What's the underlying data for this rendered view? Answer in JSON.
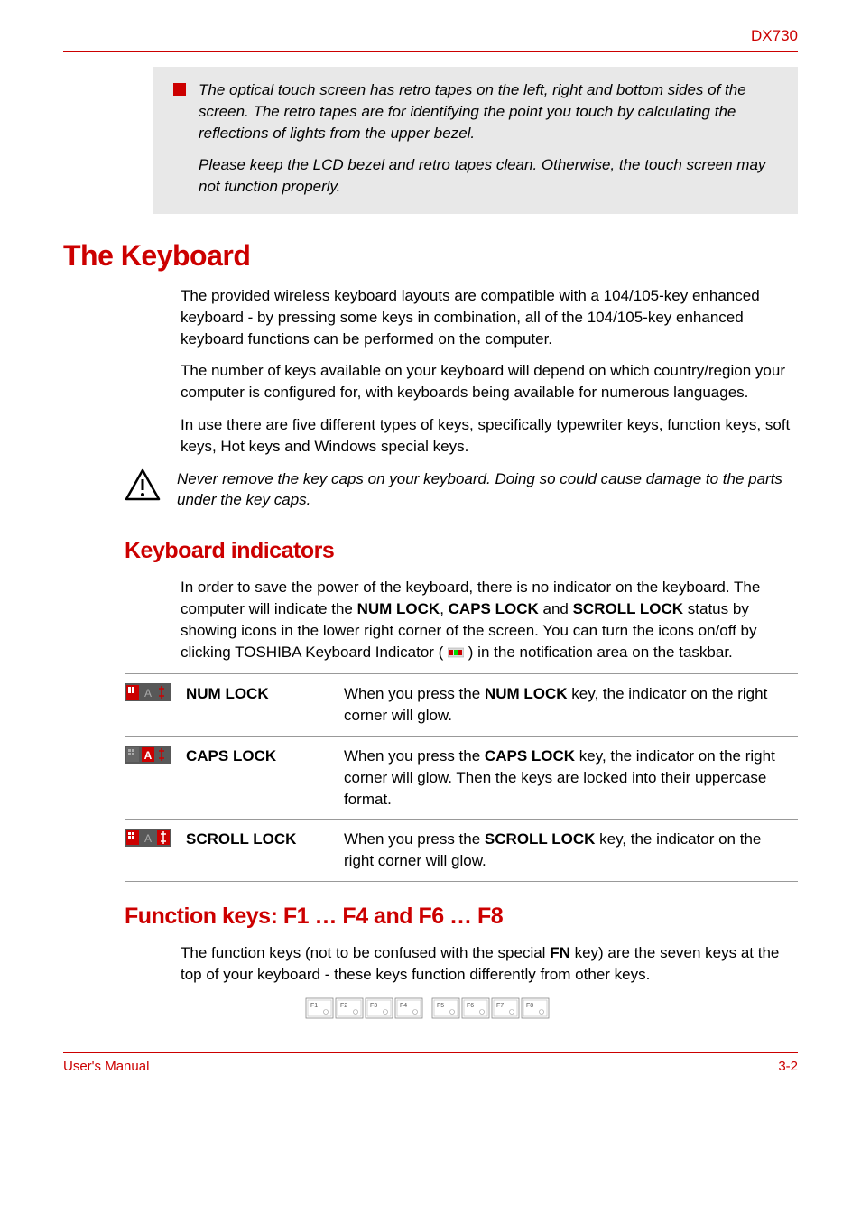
{
  "header": {
    "model": "DX730"
  },
  "note": {
    "p1": "The optical touch screen has retro tapes on the left, right and bottom sides of the screen. The retro tapes are for identifying the point you touch by calculating the reflections of lights from the upper bezel.",
    "p2": "Please keep the LCD bezel and retro tapes clean. Otherwise, the touch screen may not function properly."
  },
  "keyboard": {
    "heading": "The Keyboard",
    "p1": "The provided wireless keyboard layouts are compatible with a 104/105-key enhanced keyboard - by pressing some keys in combination, all of the 104/105-key enhanced keyboard functions can be performed on the computer.",
    "p2": "The number of keys available on your keyboard will depend on which country/region your computer is configured for, with keyboards being available for numerous languages.",
    "p3": "In use there are five different types of keys, specifically typewriter keys, function keys, soft keys, Hot keys and Windows special keys.",
    "warning": "Never remove the key caps on your keyboard. Doing so could cause damage to the parts under the key caps."
  },
  "indicators": {
    "heading": "Keyboard indicators",
    "intro_pre": "In order to save the power of the keyboard, there is no indicator on the keyboard. The computer will indicate the ",
    "numlock": "NUM LOCK",
    "capslock": "CAPS LOCK",
    "scrolllock": "SCROLL LOCK",
    "intro_mid1": ", ",
    "intro_mid2": " and ",
    "intro_mid3": " status by showing icons in the lower right corner of the screen. You can turn the icons on/off by clicking TOSHIBA Keyboard Indicator ( ",
    "intro_post": " ) in the notification area on the taskbar.",
    "rows": [
      {
        "label": "NUM LOCK",
        "desc_pre": "When you press the ",
        "desc_key": "NUM LOCK",
        "desc_post": " key, the indicator on the right corner will glow."
      },
      {
        "label": "CAPS LOCK",
        "desc_pre": "When you press the ",
        "desc_key": "CAPS LOCK",
        "desc_post": " key, the indicator on the right corner will glow. Then the keys are locked into their uppercase format."
      },
      {
        "label": "SCROLL LOCK",
        "desc_pre": "When you press the ",
        "desc_key": "SCROLL LOCK",
        "desc_post": " key, the indicator on the right corner will glow."
      }
    ]
  },
  "functionkeys": {
    "heading": "Function keys: F1 … F4 and F6 … F8",
    "p1_pre": "The function keys (not to be confused with the special ",
    "p1_key": "FN",
    "p1_post": " key) are the seven keys at the top of your keyboard - these keys function differently from other keys.",
    "keys": [
      "F1",
      "F2",
      "F3",
      "F4",
      "F5",
      "F6",
      "F7",
      "F8"
    ]
  },
  "footer": {
    "left": "User's Manual",
    "right": "3-2"
  }
}
